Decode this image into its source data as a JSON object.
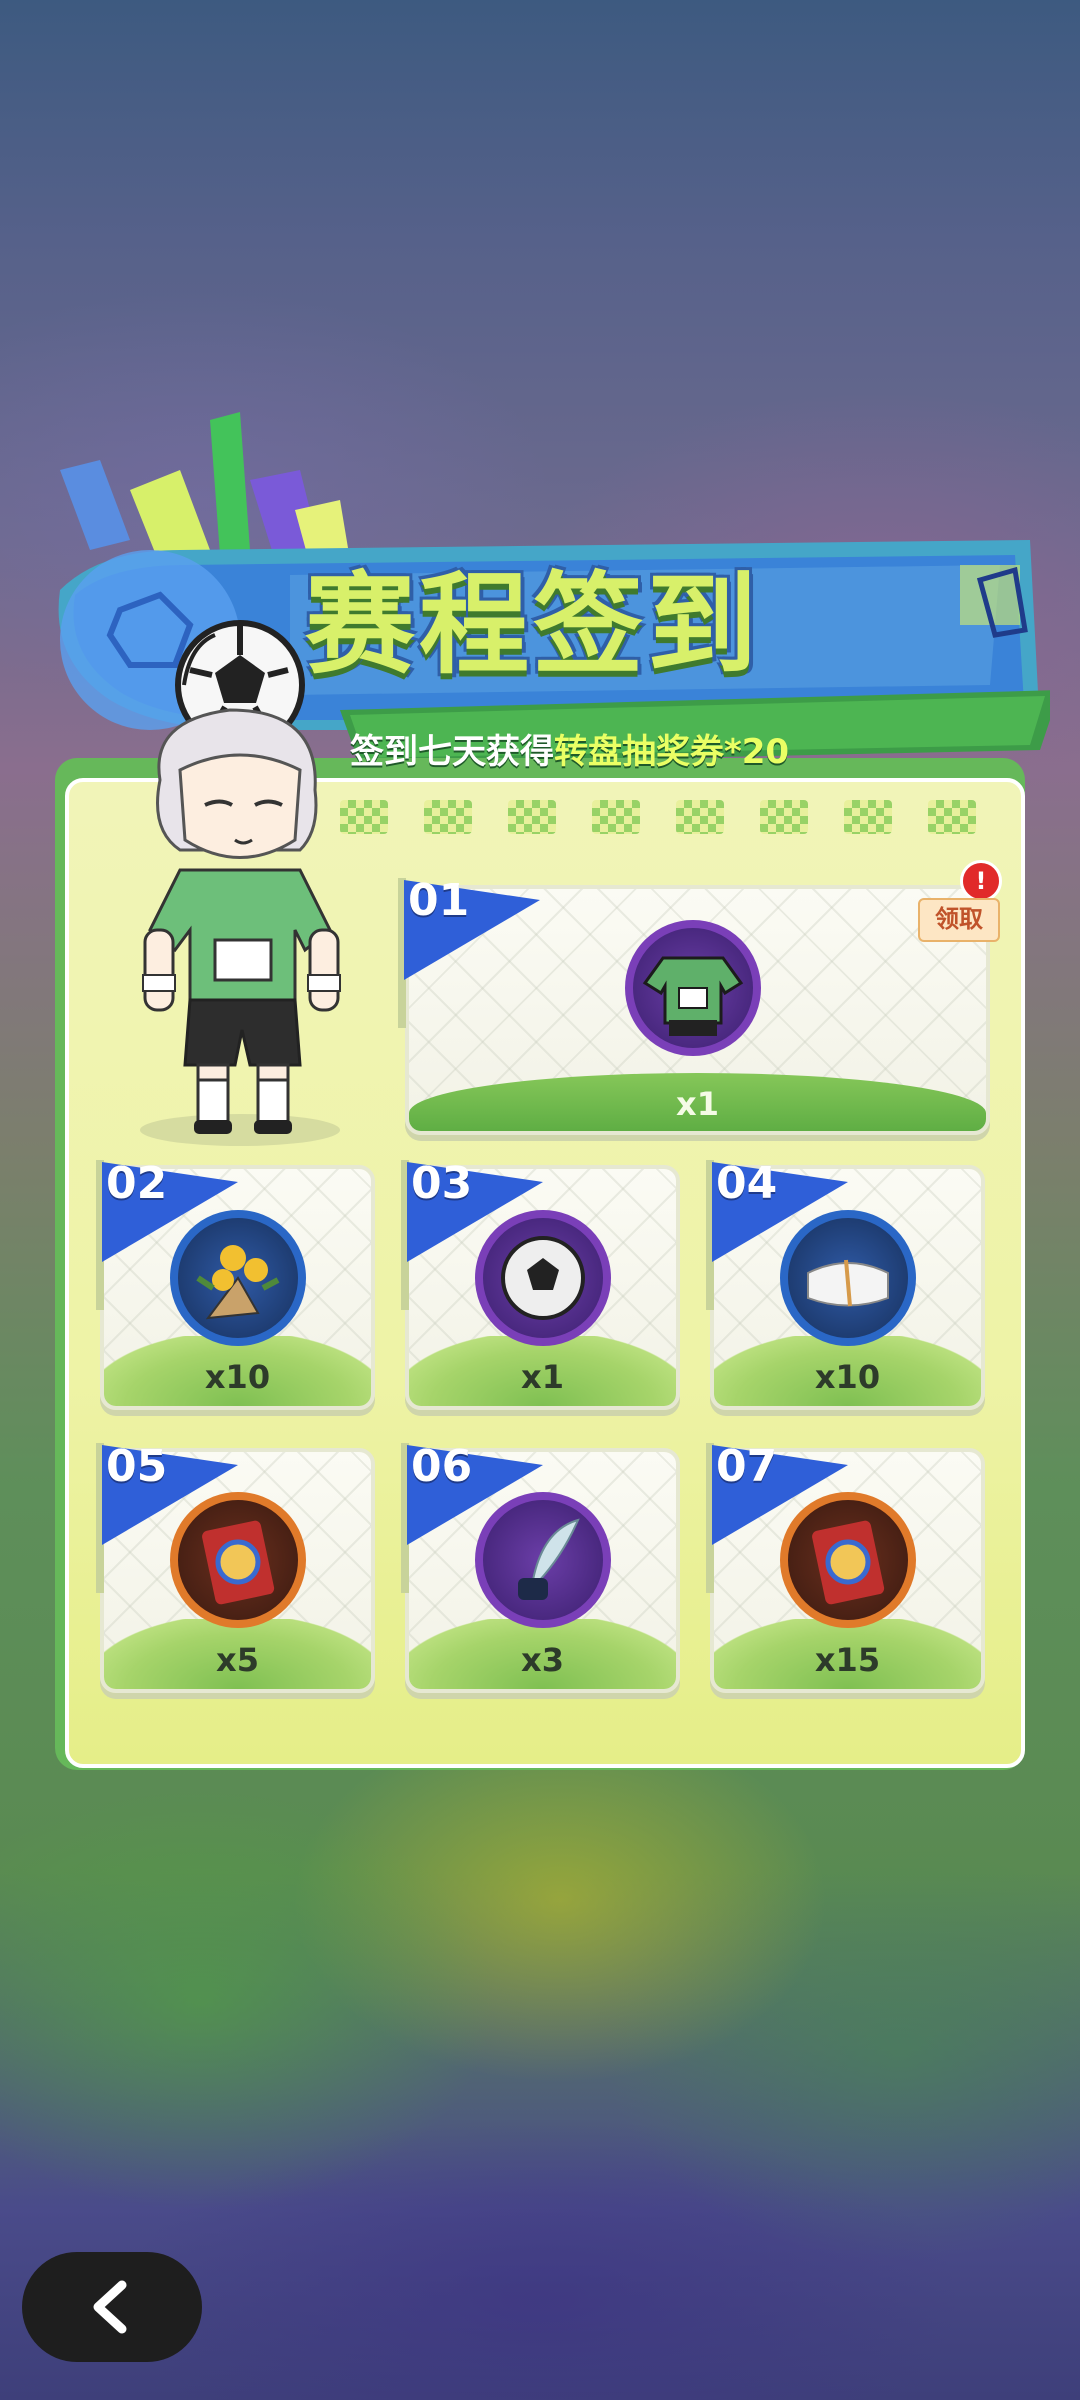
{
  "header": {
    "title": "赛程签到",
    "subtitle_prefix": "签到七天获得",
    "subtitle_highlight": "转盘抽奖券*20"
  },
  "colors": {
    "panel_green": "#66b85a",
    "title_yellow": "#d8f06a",
    "flag_blue": "#2f5fd8",
    "claim_red": "#e12a2a"
  },
  "claim": {
    "label": "领取",
    "alert": "!"
  },
  "days": [
    {
      "day": "01",
      "item": "green-jersey-icon",
      "qty": "x1"
    },
    {
      "day": "02",
      "item": "flower-bouquet-icon",
      "qty": "x10"
    },
    {
      "day": "03",
      "item": "soccer-ball-icon",
      "qty": "x1"
    },
    {
      "day": "04",
      "item": "towel-icon",
      "qty": "x10"
    },
    {
      "day": "05",
      "item": "lottery-ticket-icon",
      "qty": "x5"
    },
    {
      "day": "06",
      "item": "quill-ink-icon",
      "qty": "x3"
    },
    {
      "day": "07",
      "item": "lottery-ticket-icon",
      "qty": "x15"
    }
  ],
  "nav": {
    "back_icon": "chevron-left-icon"
  }
}
